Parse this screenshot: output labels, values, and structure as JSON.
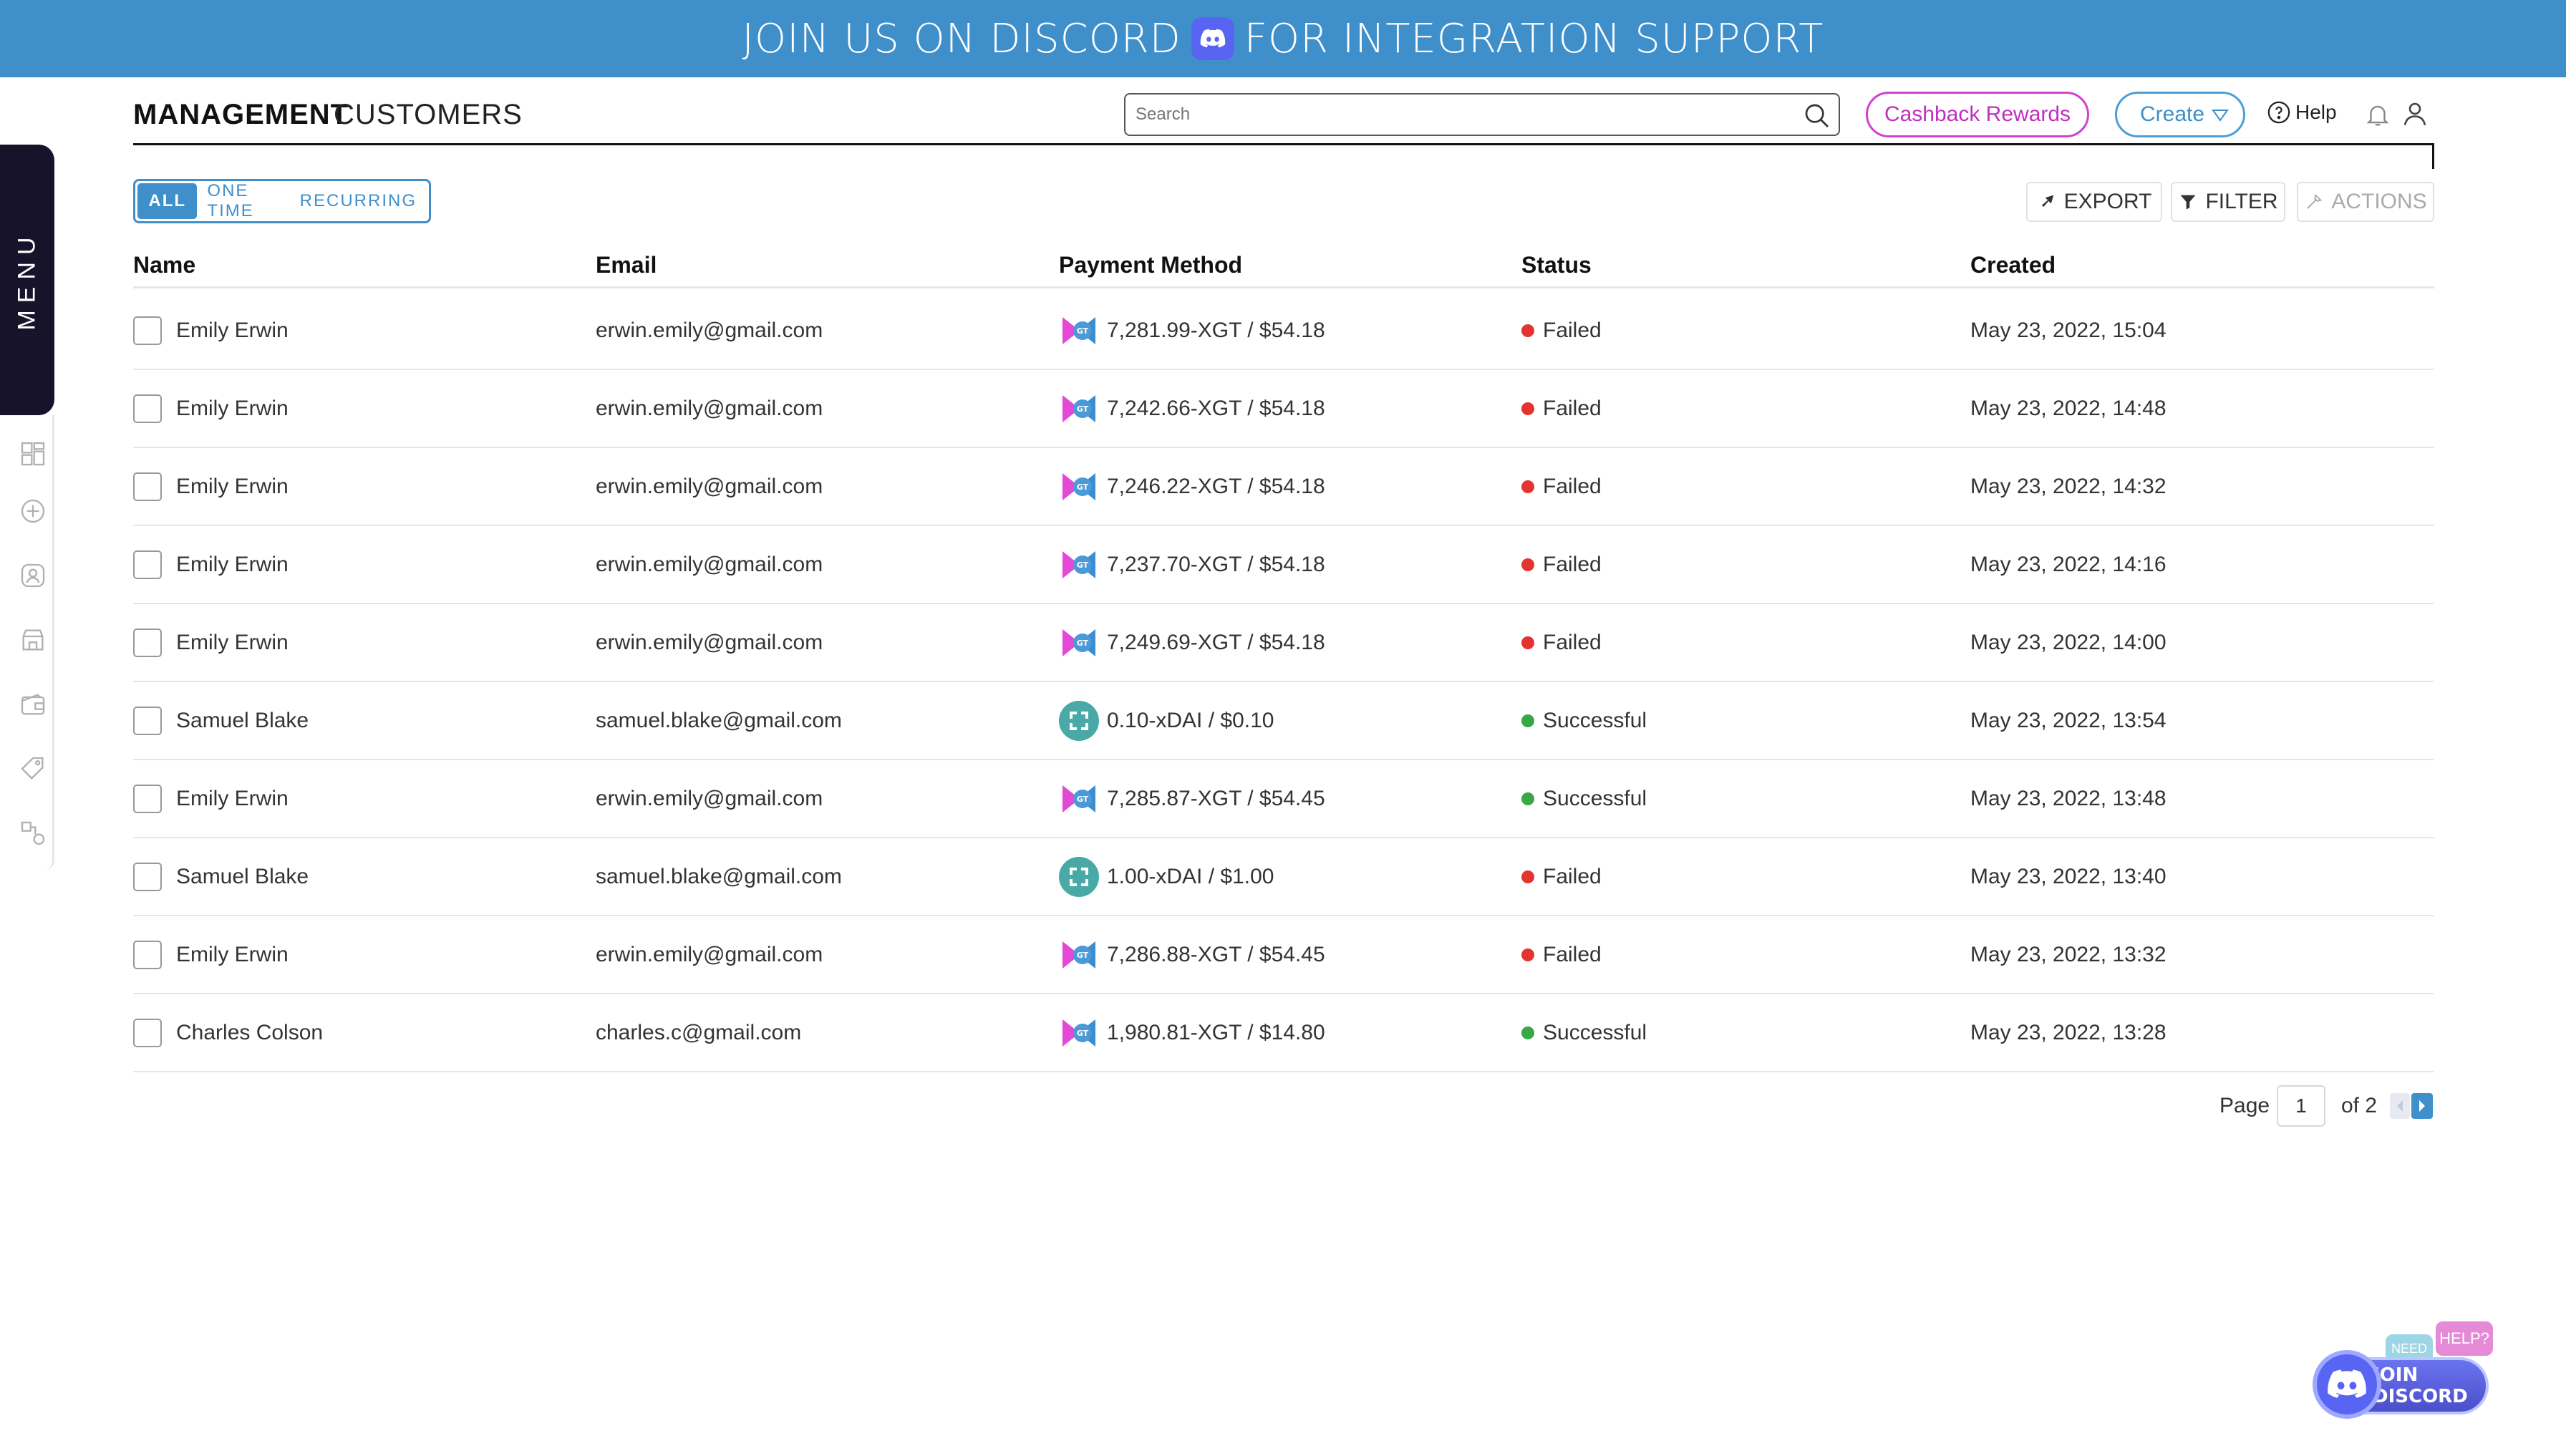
{
  "banner": {
    "text_before": "JOIN US ON DISCORD",
    "text_after": "FOR INTEGRATION SUPPORT"
  },
  "sidebar": {
    "menu_label": "MENU",
    "icons": [
      "dashboard-icon",
      "add-circle-icon",
      "customer-icon",
      "store-icon",
      "wallet-icon",
      "tag-icon",
      "integration-icon"
    ]
  },
  "header": {
    "title_main": "MANAGEMENT",
    "title_sub": "CUSTOMERS",
    "search_placeholder": "Search",
    "cashback_label": "Cashback Rewards",
    "create_label": "Create",
    "help_label": "Help"
  },
  "tabs": [
    {
      "label": "ALL",
      "active": true
    },
    {
      "label": "ONE TIME",
      "active": false
    },
    {
      "label": "RECURRING",
      "active": false
    }
  ],
  "toolbar": {
    "export_label": "EXPORT",
    "filter_label": "FILTER",
    "actions_label": "ACTIONS"
  },
  "table": {
    "columns": [
      "Name",
      "Email",
      "Payment Method",
      "Status",
      "Created"
    ],
    "rows": [
      {
        "name": "Emily Erwin",
        "email": "erwin.emily@gmail.com",
        "coin": "xgt",
        "payment": "7,281.99-XGT / $54.18",
        "status": "Failed",
        "created": "May 23, 2022, 15:04"
      },
      {
        "name": "Emily Erwin",
        "email": "erwin.emily@gmail.com",
        "coin": "xgt",
        "payment": "7,242.66-XGT / $54.18",
        "status": "Failed",
        "created": "May 23, 2022, 14:48"
      },
      {
        "name": "Emily Erwin",
        "email": "erwin.emily@gmail.com",
        "coin": "xgt",
        "payment": "7,246.22-XGT / $54.18",
        "status": "Failed",
        "created": "May 23, 2022, 14:32"
      },
      {
        "name": "Emily Erwin",
        "email": "erwin.emily@gmail.com",
        "coin": "xgt",
        "payment": "7,237.70-XGT / $54.18",
        "status": "Failed",
        "created": "May 23, 2022, 14:16"
      },
      {
        "name": "Emily Erwin",
        "email": "erwin.emily@gmail.com",
        "coin": "xgt",
        "payment": "7,249.69-XGT / $54.18",
        "status": "Failed",
        "created": "May 23, 2022, 14:00"
      },
      {
        "name": "Samuel Blake",
        "email": "samuel.blake@gmail.com",
        "coin": "xdai",
        "payment": "0.10-xDAI / $0.10",
        "status": "Successful",
        "created": "May 23, 2022, 13:54"
      },
      {
        "name": "Emily Erwin",
        "email": "erwin.emily@gmail.com",
        "coin": "xgt",
        "payment": "7,285.87-XGT / $54.45",
        "status": "Successful",
        "created": "May 23, 2022, 13:48"
      },
      {
        "name": "Samuel Blake",
        "email": "samuel.blake@gmail.com",
        "coin": "xdai",
        "payment": "1.00-xDAI / $1.00",
        "status": "Failed",
        "created": "May 23, 2022, 13:40"
      },
      {
        "name": "Emily Erwin",
        "email": "erwin.emily@gmail.com",
        "coin": "xgt",
        "payment": "7,286.88-XGT / $54.45",
        "status": "Failed",
        "created": "May 23, 2022, 13:32"
      },
      {
        "name": "Charles Colson",
        "email": "charles.c@gmail.com",
        "coin": "xgt",
        "payment": "1,980.81-XGT / $14.80",
        "status": "Successful",
        "created": "May 23, 2022, 13:28"
      }
    ]
  },
  "pagination": {
    "page_label": "Page",
    "current_page": "1",
    "of_label": "of 2"
  },
  "discord_widget": {
    "need_label": "NEED",
    "help_label": "HELP?",
    "join_label": "JOIN DISCORD"
  },
  "colors": {
    "accent": "#3f8fcb",
    "cashback": "#d53fd1",
    "failed": "#e3342f",
    "successful": "#38a745",
    "menu_bg": "#16132b"
  }
}
